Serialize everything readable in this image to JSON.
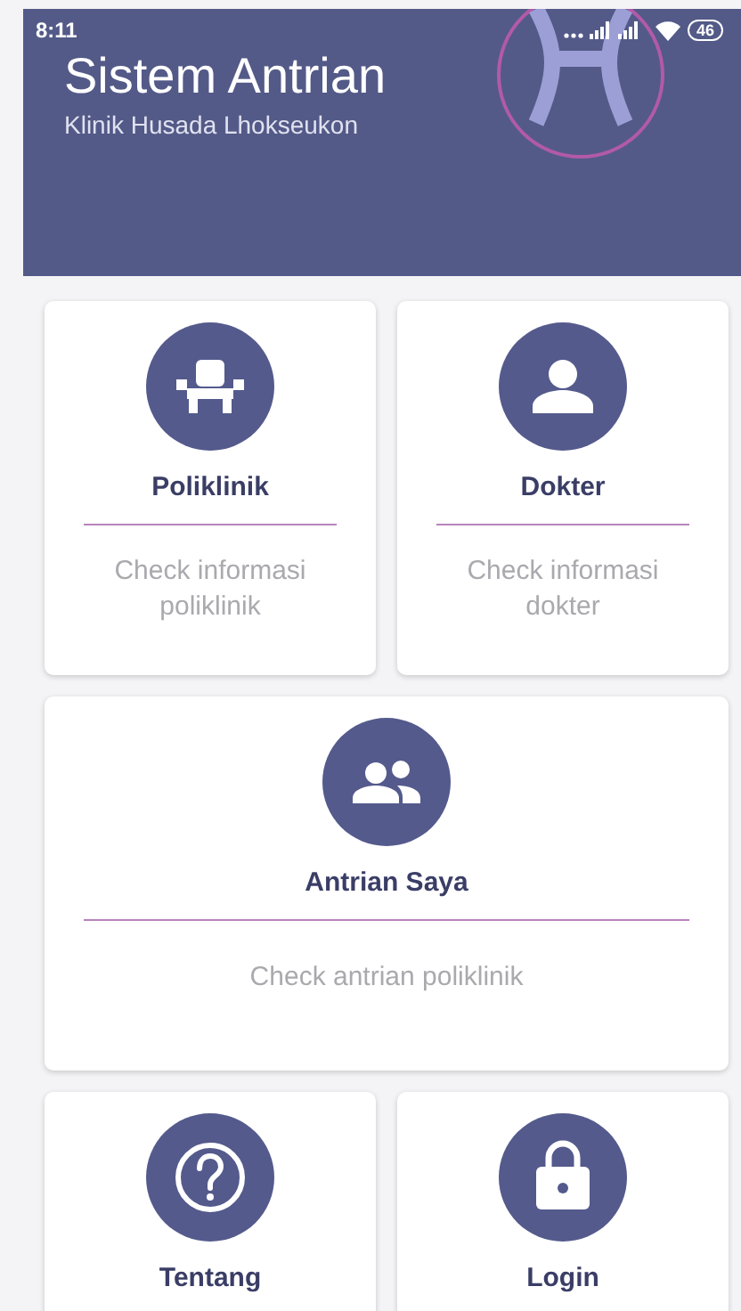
{
  "status_bar": {
    "time": "8:11",
    "battery": "46"
  },
  "header": {
    "title": "Sistem Antrian",
    "subtitle": "Klinik Husada Lhokseukon"
  },
  "menu": [
    {
      "kind": "chair",
      "title": "Poliklinik",
      "description": "Check informasi poliklinik",
      "wide": false
    },
    {
      "kind": "person",
      "title": "Dokter",
      "description": "Check informasi dokter",
      "wide": false
    },
    {
      "kind": "group",
      "title": "Antrian Saya",
      "description": "Check antrian poliklinik",
      "wide": true
    },
    {
      "kind": "help",
      "title": "Tentang",
      "wide": false
    },
    {
      "kind": "lock",
      "title": "Login",
      "wide": false
    }
  ]
}
